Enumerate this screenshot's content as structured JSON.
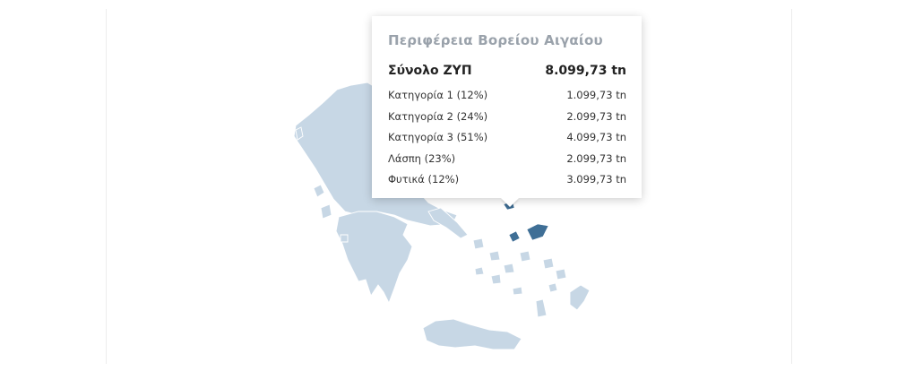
{
  "tooltip": {
    "region": "Περιφέρεια Βορείου Αιγαίου",
    "total_label": "Σύνολο ΖΥΠ",
    "total_value": "8.099,73 tn",
    "rows": [
      {
        "label": "Κατηγορία 1 (12%)",
        "value": "1.099,73 tn"
      },
      {
        "label": "Κατηγορία 2 (24%)",
        "value": "2.099,73 tn"
      },
      {
        "label": "Κατηγορία 3 (51%)",
        "value": "4.099,73 tn"
      },
      {
        "label": "Λάσπη (23%)",
        "value": "2.099,73 tn"
      },
      {
        "label": "Φυτικά (12%)",
        "value": "3.099,73 tn"
      }
    ]
  },
  "map": {
    "country": "Greece",
    "highlighted_region": "North Aegean",
    "colors": {
      "region_fill": "#c7d7e5",
      "selected_fill": "#3f6f96",
      "border": "#ffffff"
    }
  }
}
